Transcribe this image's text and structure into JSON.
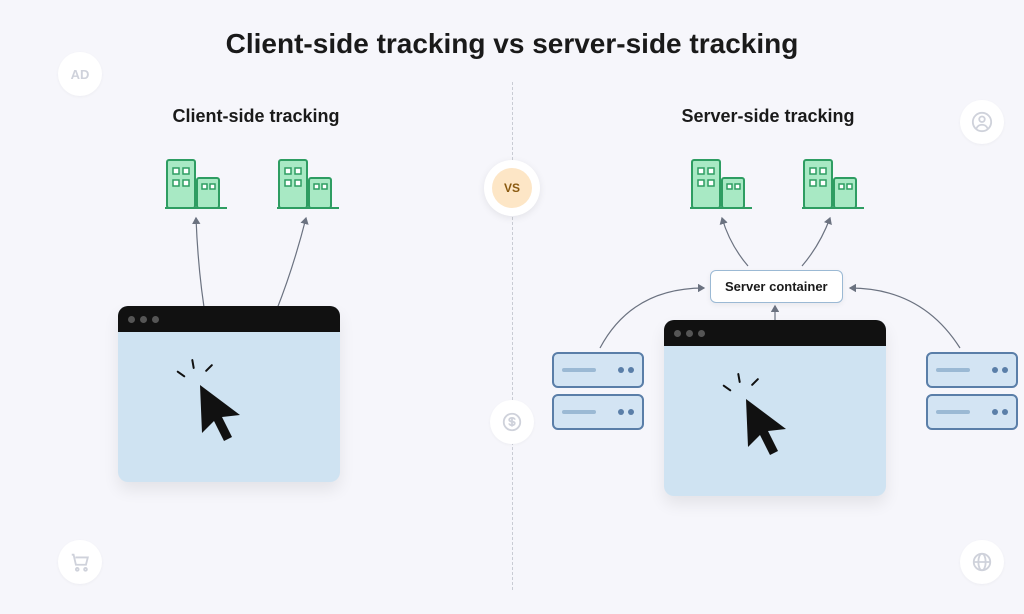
{
  "title": "Client-side tracking vs server-side tracking",
  "vs_label": "VS",
  "left": {
    "title": "Client-side tracking"
  },
  "right": {
    "title": "Server-side tracking",
    "server_container_label": "Server container"
  },
  "bg_icons": {
    "ad_label": "AD"
  }
}
